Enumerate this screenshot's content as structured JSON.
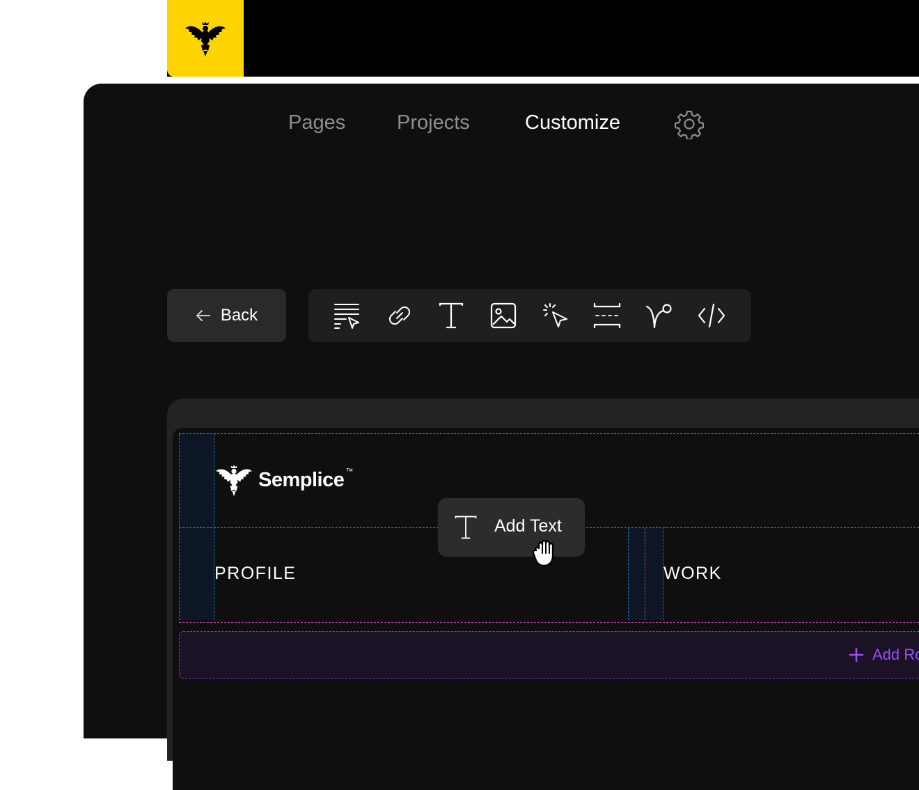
{
  "nav": {
    "items": [
      {
        "label": "Pages",
        "active": false
      },
      {
        "label": "Projects",
        "active": false
      },
      {
        "label": "Customize",
        "active": true
      }
    ],
    "settings_icon": "gear-icon",
    "logo_icon": "eagle-logo-icon",
    "logo_bg": "#ffd400"
  },
  "toolbar": {
    "back_label": "Back",
    "tools": [
      "text-editor-icon",
      "link-icon",
      "text-icon",
      "image-icon",
      "cursor-click-icon",
      "spacer-icon",
      "branch-icon",
      "code-icon"
    ]
  },
  "canvas": {
    "brand_name": "Semplice",
    "brand_tm": "™",
    "menu": [
      "PROFILE",
      "WORK"
    ],
    "add_text_label": "Add Text",
    "add_row_label": "Add Row"
  },
  "colors": {
    "accent_purple": "#9a4df2",
    "section_guide": "#c23fa1",
    "column_guide": "#2b74b5"
  }
}
